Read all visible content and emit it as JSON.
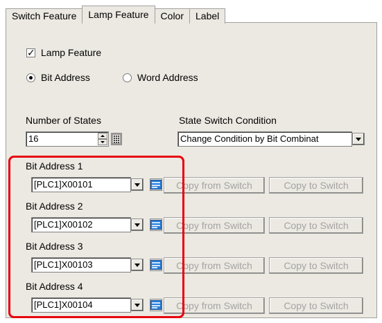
{
  "tabs": [
    {
      "label": "Switch Feature"
    },
    {
      "label": "Lamp Feature"
    },
    {
      "label": "Color"
    },
    {
      "label": "Label"
    }
  ],
  "lamp_feature": {
    "checkbox_label": "Lamp Feature",
    "checked": true,
    "address_type": {
      "bit_label": "Bit Address",
      "word_label": "Word Address",
      "selected": "Bit Address"
    },
    "states_label": "Number of States",
    "states_value": "16",
    "switch_condition_label": "State Switch Condition",
    "switch_condition_value": "Change Condition by Bit Combinat"
  },
  "bit_addresses": [
    {
      "label": "Bit Address 1",
      "value": "[PLC1]X00101",
      "copy_from": "Copy from Switch",
      "copy_to": "Copy to Switch"
    },
    {
      "label": "Bit Address 2",
      "value": "[PLC1]X00102",
      "copy_from": "Copy from Switch",
      "copy_to": "Copy to Switch"
    },
    {
      "label": "Bit Address 3",
      "value": "[PLC1]X00103",
      "copy_from": "Copy from Switch",
      "copy_to": "Copy to Switch"
    },
    {
      "label": "Bit Address 4",
      "value": "[PLC1]X00104",
      "copy_from": "Copy from Switch",
      "copy_to": "Copy to Switch"
    }
  ],
  "colors": {
    "highlight": "#e8000b",
    "panel_bg": "#ece9e2",
    "disabled_text": "#a3a3a3"
  }
}
